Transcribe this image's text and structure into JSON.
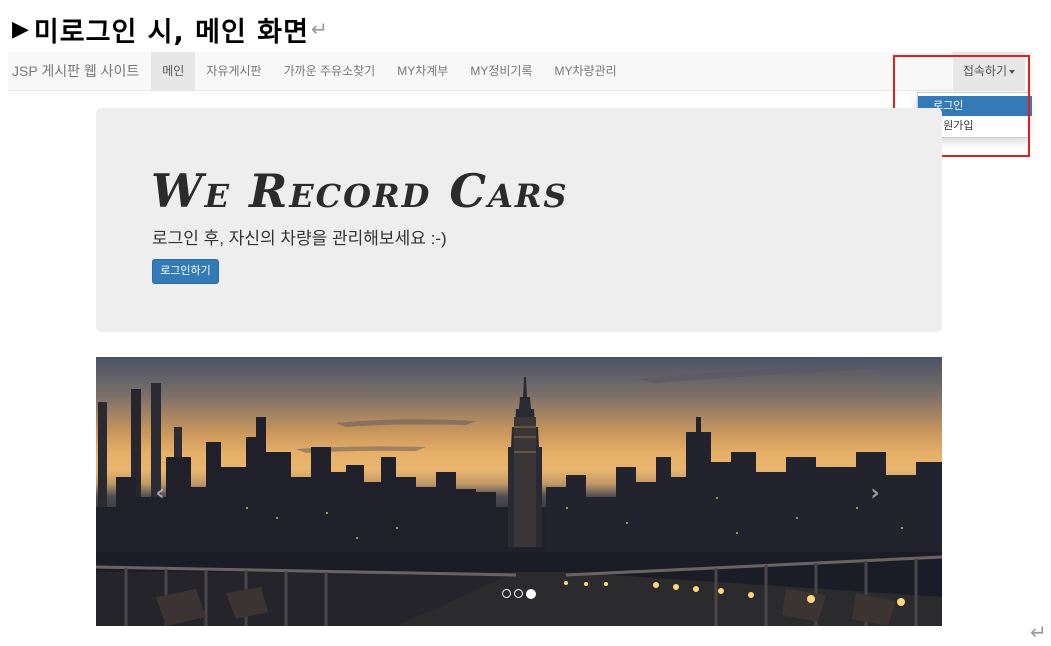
{
  "doc": {
    "heading": "미로그인 시, 메인 화면",
    "heading_arrow": "▶",
    "return_mark": "↵"
  },
  "navbar": {
    "brand": "JSP 게시판 웹 사이트",
    "items": [
      {
        "label": "메인",
        "active": true
      },
      {
        "label": "자유게시판"
      },
      {
        "label": "가까운 주유소찾기"
      },
      {
        "label": "MY차계부"
      },
      {
        "label": "MY정비기록"
      },
      {
        "label": "MY차량관리"
      }
    ],
    "right_menu": {
      "label": "접속하기",
      "items": [
        {
          "label": "로그인",
          "selected": true
        },
        {
          "label": "회원가입"
        }
      ]
    }
  },
  "jumbotron": {
    "title": "We Record Cars",
    "subtitle": "로그인 후, 자신의 차량을 관리해보세요 :-)",
    "button": "로그인하기"
  },
  "carousel": {
    "image": "city-skyline-sunset-pier",
    "prev_icon": "‹",
    "next_icon": "›",
    "slide_count": 3,
    "active_slide": 3
  },
  "colors": {
    "primary": "#337ab7",
    "navbar_bg": "#f8f8f8",
    "jumbotron_bg": "#eeeeee",
    "highlight": "#e02020"
  }
}
